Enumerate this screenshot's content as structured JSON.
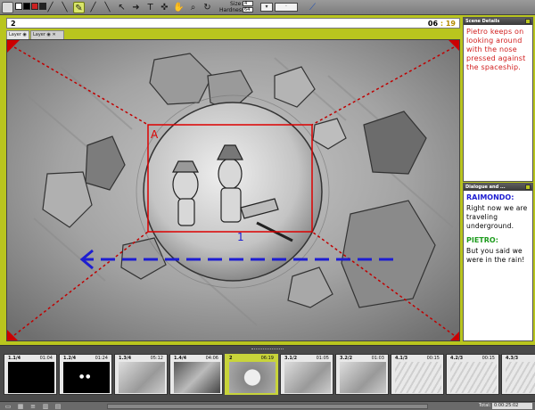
{
  "toolbar": {
    "colors": [
      "#ffffff",
      "#000000",
      "#cc2222",
      "#222222"
    ],
    "tools": [
      {
        "name": "pencil-tool-icon",
        "glyph": "╱"
      },
      {
        "name": "brush-tool-icon",
        "glyph": "╲"
      },
      {
        "name": "pen-tool-icon",
        "glyph": "✎"
      },
      {
        "name": "marker-tool-icon",
        "glyph": "╱"
      },
      {
        "name": "eraser-tool-icon",
        "glyph": "╲"
      },
      {
        "name": "select-tool-icon",
        "glyph": "↖"
      },
      {
        "name": "arrow-tool-icon",
        "glyph": "➜"
      },
      {
        "name": "text-tool-icon",
        "glyph": "T"
      },
      {
        "name": "transform-tool-icon",
        "glyph": "✜"
      },
      {
        "name": "hand-tool-icon",
        "glyph": "✋"
      },
      {
        "name": "zoom-tool-icon",
        "glyph": "⌕"
      },
      {
        "name": "rotate-tool-icon",
        "glyph": "↻"
      }
    ],
    "size_label": "Size:",
    "size_value": "4",
    "hardness_label": "Hardness:",
    "hardness_value": "64"
  },
  "panel": {
    "number": "2",
    "time_seconds": "06",
    "time_sep": ":",
    "time_frames": "19"
  },
  "layer_tabs": [
    {
      "label": "Layer"
    },
    {
      "label": "Layer"
    }
  ],
  "sidebar": {
    "scene_header": "Scene Details",
    "scene_text": "Pietro keeps on looking around with the nose pressed against the spaceship.",
    "dialogue_header": "Dialogue and ...",
    "dialogue": [
      {
        "speaker": "RAIMONDO:",
        "speaker_color": "#1d1dd1",
        "line": "Right now we are traveling underground."
      },
      {
        "speaker": "PIETRO:",
        "speaker_color": "#1e9c1e",
        "line": "But you said we were in the rain!"
      }
    ]
  },
  "canvas_marks": {
    "label_a": "A",
    "label_b": "1"
  },
  "thumbnails": [
    {
      "name": "1.1/4",
      "duration": "01:04",
      "style": "black",
      "selected": false
    },
    {
      "name": "1.2/4",
      "duration": "01:24",
      "style": "black-eyes",
      "selected": false
    },
    {
      "name": "1.3/4",
      "duration": "05:12",
      "style": "sketch",
      "selected": false
    },
    {
      "name": "1.4/4",
      "duration": "04:06",
      "style": "sketch-dark",
      "selected": false
    },
    {
      "name": "2",
      "duration": "06:19",
      "style": "bubble",
      "selected": true
    },
    {
      "name": "3.1/2",
      "duration": "01:05",
      "style": "sketch",
      "selected": false
    },
    {
      "name": "3.2/2",
      "duration": "01:03",
      "style": "sketch",
      "selected": false
    },
    {
      "name": "4.1/3",
      "duration": "00:15",
      "style": "rain",
      "selected": false
    },
    {
      "name": "4.2/3",
      "duration": "00:15",
      "style": "rain",
      "selected": false
    },
    {
      "name": "4.3/3",
      "duration": "",
      "style": "rain",
      "selected": false
    }
  ],
  "statusbar": {
    "total_label": "Total:",
    "total_value": "0:00:25:02"
  }
}
